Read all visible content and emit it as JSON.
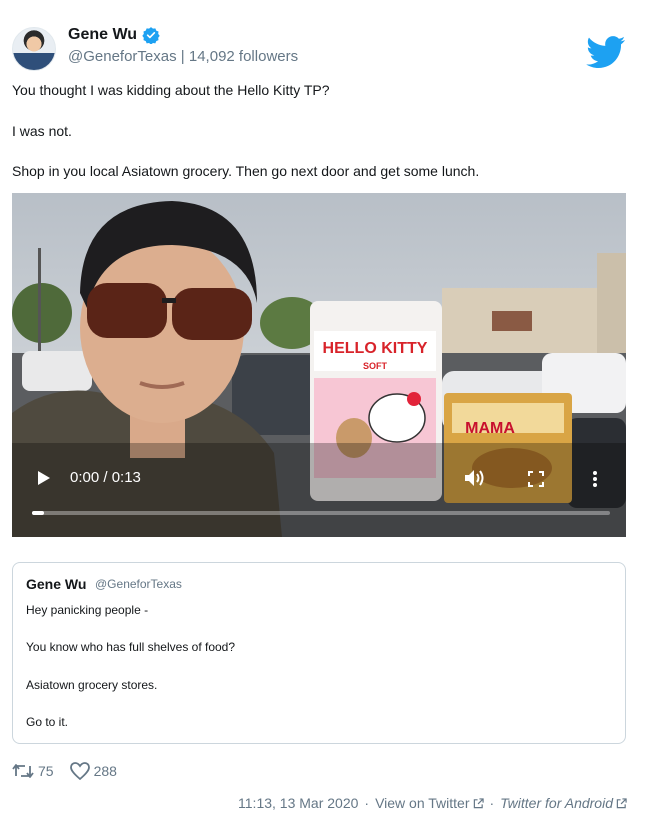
{
  "author": {
    "display_name": "Gene Wu",
    "handle": "@GeneforTexas",
    "followers": "14,092 followers",
    "verified": true
  },
  "tweet": {
    "lines": [
      "You thought I was kidding about the Hello Kitty TP?",
      "I was not.",
      "Shop in you local Asiatown grocery. Then go next door and get some lunch."
    ]
  },
  "video": {
    "time": "0:00 / 0:13",
    "progress": 0.02,
    "package_brand": "HELLO KITTY",
    "package_sub": "SOFT",
    "box_brand": "MAMA"
  },
  "quoted_tweet": {
    "display_name": "Gene Wu",
    "handle": "@GeneforTexas",
    "lines": [
      "Hey panicking people -",
      "You know who has full shelves of food?",
      "Asiatown grocery stores.",
      "Go to it."
    ]
  },
  "actions": {
    "retweets": "75",
    "likes": "288"
  },
  "footer": {
    "timestamp": "11:13, 13 Mar 2020",
    "view_on": "View on Twitter",
    "client": "Twitter for Android"
  },
  "colors": {
    "twitter_blue": "#1da1f2",
    "secondary_text": "#657786",
    "border": "#ccd6dd"
  },
  "icons": [
    "verified-icon",
    "twitter-bird-icon",
    "play-icon",
    "volume-icon",
    "fullscreen-icon",
    "more-icon",
    "retweet-icon",
    "heart-icon",
    "external-link-icon"
  ]
}
